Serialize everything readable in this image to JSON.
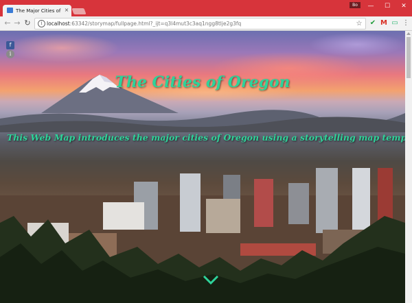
{
  "browser": {
    "tab_title": "The Major Cities of Oreg",
    "tab_close": "×",
    "user_badge": "Bo",
    "window_controls": {
      "minimize": "—",
      "maximize": "☐",
      "close": "✕"
    },
    "nav": {
      "back": "←",
      "forward": "→",
      "reload": "↻"
    },
    "url_host": "localhost",
    "url_path": ":63342/storymap/fullpage.html?_ijt=q3l4mut3c3aq1ngg8tlje2g3fq",
    "info_icon": "i",
    "bookmark_icon": "☆",
    "extensions": [
      {
        "icon": "check-icon",
        "glyph": "✔",
        "color": "#1f9d3a"
      },
      {
        "icon": "gmail-icon",
        "glyph": "M",
        "color": "#d93025"
      },
      {
        "icon": "cast-icon",
        "glyph": "▭",
        "color": "#2bb673"
      },
      {
        "icon": "menu-icon",
        "glyph": "⋮",
        "color": "#555555"
      }
    ],
    "colors": {
      "frame": "#d7343b",
      "toolbar": "#f2f2f2"
    }
  },
  "page": {
    "title": "The Cities of Oregon",
    "subtitle": "This Web Map introduces the major cities of Oregon using a storytelling map template.",
    "social": [
      {
        "icon": "facebook-icon",
        "glyph": "f",
        "color": "#3b5998"
      },
      {
        "icon": "info-icon",
        "glyph": "i",
        "color": "#8a8a8a"
      }
    ],
    "accent_color": "#2ed39a"
  }
}
